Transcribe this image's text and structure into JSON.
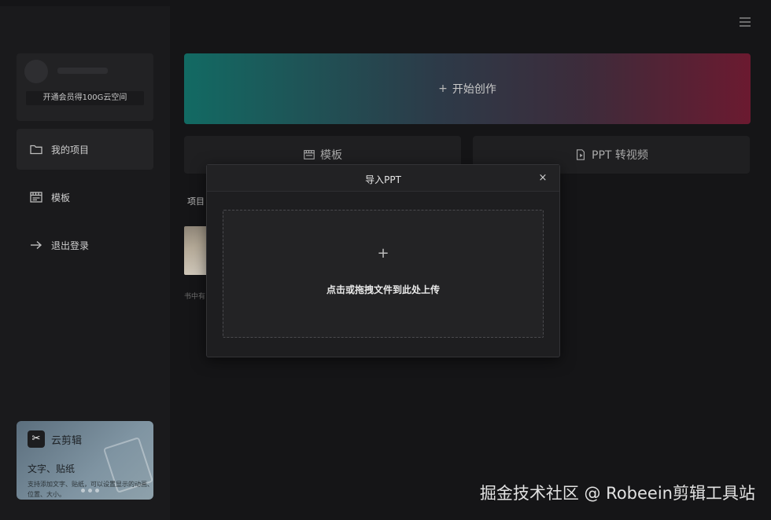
{
  "sidebar": {
    "vip_label": "开通会员得100G云空间",
    "items": [
      {
        "label": "我的项目",
        "icon": "folder-icon"
      },
      {
        "label": "模板",
        "icon": "template-icon"
      },
      {
        "label": "退出登录",
        "icon": "arrow-right-icon"
      }
    ],
    "promo": {
      "brand": "云剪辑",
      "title": "文字、贴纸",
      "desc": "支持添加文字、贴纸，可以设置显示的动画、位置、大小。"
    }
  },
  "main": {
    "create_label": "开始创作",
    "tools": [
      {
        "label": "模板",
        "icon": "template-icon"
      },
      {
        "label": "PPT 转视频",
        "icon": "ppt-video-icon"
      }
    ],
    "section_label": "项目",
    "project_name": "书中有"
  },
  "modal": {
    "title": "导入PPT",
    "close_glyph": "×",
    "upload_glyph": "+",
    "upload_text": "点击或拖拽文件到此处上传"
  },
  "watermark": "掘金技术社区 @ Robeein剪辑工具站"
}
